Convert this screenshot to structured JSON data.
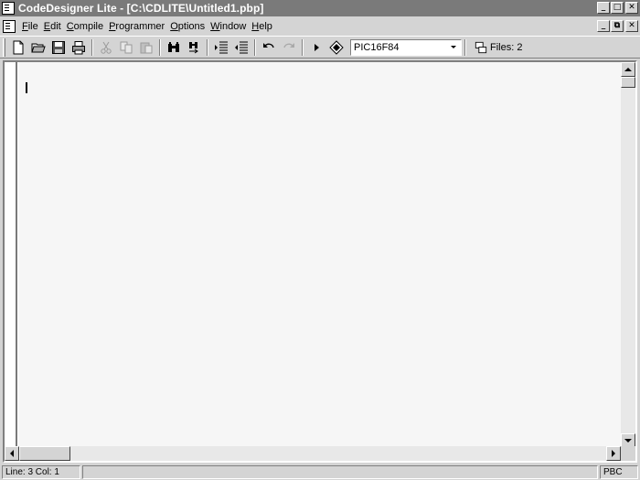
{
  "window": {
    "title": "CodeDesigner Lite - [C:\\CDLITE\\Untitled1.pbp]",
    "minimize_glyph": "_",
    "maximize_glyph": "□",
    "restore_glyph": "⧉",
    "close_glyph": "✕"
  },
  "menu": {
    "items": [
      {
        "label": "File",
        "accel": "F",
        "rest": "ile"
      },
      {
        "label": "Edit",
        "accel": "E",
        "rest": "dit"
      },
      {
        "label": "Compile",
        "accel": "C",
        "rest": "ompile"
      },
      {
        "label": "Programmer",
        "accel": "P",
        "rest": "rogrammer"
      },
      {
        "label": "Options",
        "accel": "O",
        "rest": "ptions"
      },
      {
        "label": "Window",
        "accel": "W",
        "rest": "indow"
      },
      {
        "label": "Help",
        "accel": "H",
        "rest": "elp"
      }
    ]
  },
  "toolbar": {
    "chip_value": "PIC16F84",
    "files_label": "Files: 2",
    "icons": [
      "new-file-icon",
      "open-folder-icon",
      "save-disk-icon",
      "print-icon",
      "cut-icon",
      "copy-icon",
      "paste-icon",
      "find-binoculars-icon",
      "find-replace-icon",
      "indent-icon",
      "outdent-icon",
      "undo-icon",
      "redo-icon",
      "compile-run-icon",
      "program-chip-icon",
      "files-icon"
    ]
  },
  "editor": {
    "content": ""
  },
  "statusbar": {
    "position": "Line: 3  Col: 1",
    "mode": "",
    "language": "PBC"
  },
  "colors": {
    "titlebar": "#7a7a7a",
    "face": "#d4d4d4",
    "editor_bg": "#f6f6f6"
  }
}
